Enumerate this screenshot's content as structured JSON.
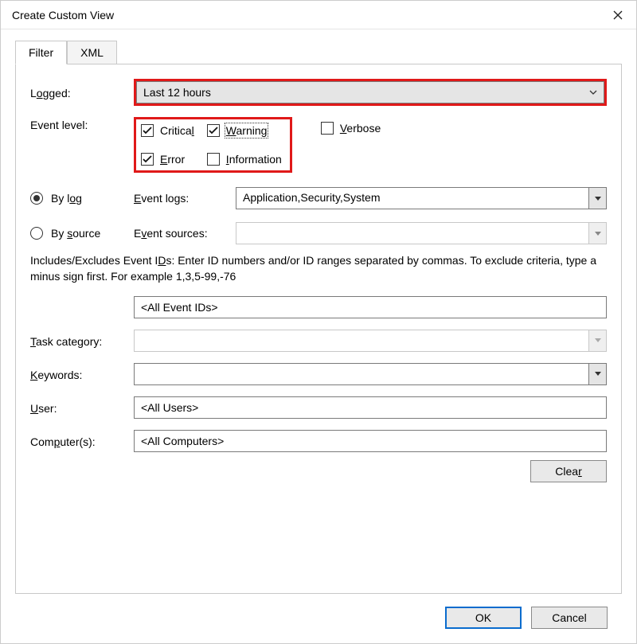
{
  "window": {
    "title": "Create Custom View"
  },
  "tabs": {
    "filter": "Filter",
    "xml": "XML"
  },
  "labels": {
    "logged": "Logged:",
    "event_level": "Event level:",
    "by_log": "By log",
    "by_source": "By source",
    "event_logs": "Event logs:",
    "event_sources": "Event sources:",
    "task_category": "Task category:",
    "keywords": "Keywords:",
    "user": "User:",
    "computers": "Computer(s):"
  },
  "help_text": "Includes/Excludes Event IDs: Enter ID numbers and/or ID ranges separated by commas. To exclude criteria, type a minus sign first. For example 1,3,5-99,-76",
  "values": {
    "logged": "Last 12 hours",
    "event_logs": "Application,Security,System",
    "event_sources": "",
    "event_ids_placeholder": "<All Event IDs>",
    "task_category": "",
    "keywords": "",
    "user": "<All Users>",
    "computers": "<All Computers>"
  },
  "levels": {
    "critical": {
      "label": "Critical",
      "checked": true
    },
    "warning": {
      "label": "Warning",
      "checked": true
    },
    "error": {
      "label": "Error",
      "checked": true
    },
    "information": {
      "label": "Information",
      "checked": false
    },
    "verbose": {
      "label": "Verbose",
      "checked": false
    }
  },
  "buttons": {
    "clear": "Clear",
    "ok": "OK",
    "cancel": "Cancel"
  },
  "underline_chars": {
    "logged": "o",
    "critical": "l",
    "warning": "W",
    "verbose": "V",
    "error": "E",
    "information": "I",
    "by_log": "o",
    "by_source": "s",
    "event_logs": "E",
    "event_sources": "v",
    "event_ids": "D",
    "task_category": "T",
    "keywords": "K",
    "user": "U",
    "computers": "p",
    "clear": "r"
  },
  "highlight_color": "#e01919"
}
